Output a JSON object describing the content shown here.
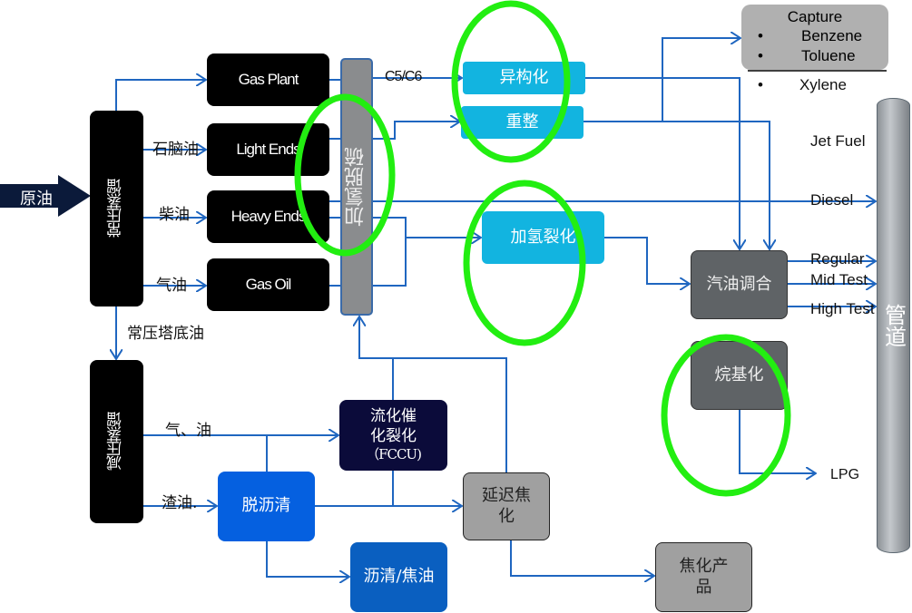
{
  "input": "原油",
  "atmospheric_distillation": "常压蒸馏",
  "vacuum_distillation": "减压蒸馏",
  "fractions": [
    "Gas Plant",
    "Light Ends",
    "Heavy Ends",
    "Gas Oil"
  ],
  "fraction_labels": [
    "石脑油",
    "柴油",
    "气油"
  ],
  "bottoms_label": "常压塔底油",
  "hydrodesulfurization": "加氢脱硫",
  "c5c6": "C5/C6",
  "isomerization": "异构化",
  "reforming": "重整",
  "hydrocracking": "加氢裂化",
  "capture": {
    "title": "Capture",
    "items": [
      "Benzene",
      "Toluene",
      "Xylene"
    ],
    "bullet": "•"
  },
  "products": {
    "jet_fuel": "Jet Fuel",
    "diesel": "Diesel",
    "regular": "Regular",
    "mid_test": "Mid Test",
    "high_test": "High Test",
    "lpg": "LPG"
  },
  "gasoline_blending": "汽油调合",
  "alkylation": "烷基化",
  "pipeline": "管道",
  "vacuum_labels": {
    "gas_oil": "气、油",
    "residue": "渣油."
  },
  "fccu": {
    "line1": "流化催",
    "line2": "化裂化",
    "line3": "（FCCU)"
  },
  "deasphalting": "脱沥清",
  "delayed_coking": "延迟焦化",
  "asphalt_tar": "沥清/焦油",
  "coking_products": "焦化产品",
  "colors": {
    "line": "#1f66c0",
    "highlight": "#22ee11",
    "cyan": "#12b4e0",
    "blue": "#0560e0",
    "navy": "#0b0b3a"
  }
}
